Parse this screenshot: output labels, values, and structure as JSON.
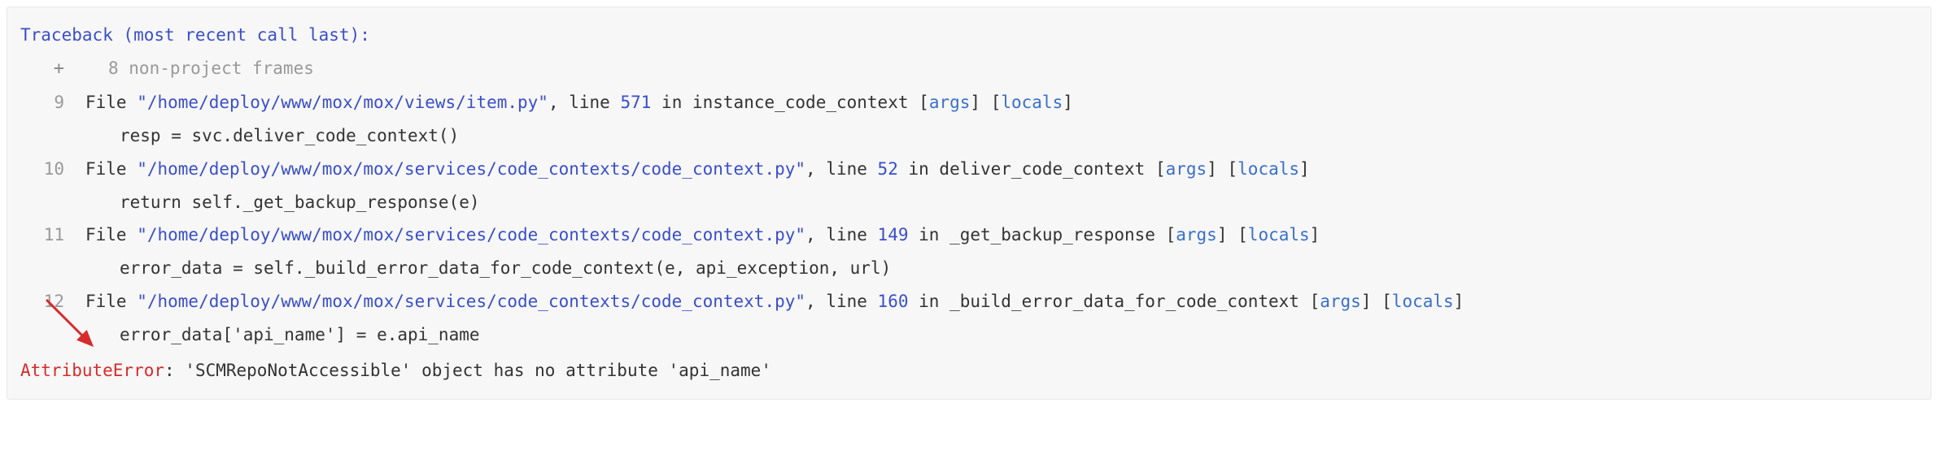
{
  "header": "Traceback (most recent call last):",
  "collapsed": {
    "symbol": "+",
    "text": "8 non-project frames"
  },
  "frames": [
    {
      "num": "9",
      "path": "\"/home/deploy/www/mox/mox/views/item.py\"",
      "line": "571",
      "func": "instance_code_context",
      "src": "resp = svc.deliver_code_context()"
    },
    {
      "num": "10",
      "path": "\"/home/deploy/www/mox/mox/services/code_contexts/code_context.py\"",
      "line": "52",
      "func": "deliver_code_context",
      "src": "return self._get_backup_response(e)"
    },
    {
      "num": "11",
      "path": "\"/home/deploy/www/mox/mox/services/code_contexts/code_context.py\"",
      "line": "149",
      "func": "_get_backup_response",
      "src": "error_data = self._build_error_data_for_code_context(e, api_exception, url)"
    },
    {
      "num": "12",
      "path": "\"/home/deploy/www/mox/mox/services/code_contexts/code_context.py\"",
      "line": "160",
      "func": "_build_error_data_for_code_context",
      "src": "error_data['api_name'] = e.api_name"
    }
  ],
  "links": {
    "args": "args",
    "locals": "locals"
  },
  "labels": {
    "file": "File ",
    "line": ", line ",
    "in": " in "
  },
  "error": {
    "type": "AttributeError",
    "msg": ": 'SCMRepoNotAccessible' object has no attribute 'api_name'"
  }
}
